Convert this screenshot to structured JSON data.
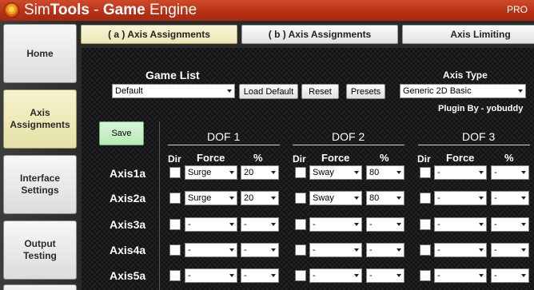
{
  "titlebar": {
    "brand_light": "Sim",
    "brand_bold": "Tools",
    "separator": " - ",
    "module_bold": "Game",
    "module_light": " Engine",
    "edition": "PRO"
  },
  "sidebar": {
    "items": [
      {
        "label": "Home"
      },
      {
        "label": "Axis Assignments",
        "active": true
      },
      {
        "label": "Interface Settings"
      },
      {
        "label": "Output Testing"
      }
    ]
  },
  "tabs": [
    {
      "label": "( a ) Axis Assignments",
      "active": true
    },
    {
      "label": "( b ) Axis Assignments"
    },
    {
      "label": "Axis Limiting"
    }
  ],
  "game_list": {
    "heading": "Game List",
    "selected": "Default"
  },
  "buttons": {
    "load_default": "Load Default",
    "reset": "Reset",
    "presets": "Presets",
    "save": "Save"
  },
  "axis_type": {
    "heading": "Axis Type",
    "selected": "Generic 2D Basic"
  },
  "plugin_by": "Plugin By - yobuddy",
  "dof_headers": [
    "DOF 1",
    "DOF 2",
    "DOF 3"
  ],
  "col_headers": {
    "dir": "Dir",
    "force": "Force",
    "percent": "%"
  },
  "axes": [
    {
      "name": "Axis1a",
      "dof": [
        {
          "force": "Surge",
          "percent": "20"
        },
        {
          "force": "Sway",
          "percent": "80"
        },
        {
          "force": "-",
          "percent": "-"
        }
      ]
    },
    {
      "name": "Axis2a",
      "dof": [
        {
          "force": "Surge",
          "percent": "20"
        },
        {
          "force": "Sway",
          "percent": "80"
        },
        {
          "force": "-",
          "percent": "-"
        }
      ]
    },
    {
      "name": "Axis3a",
      "dof": [
        {
          "force": "-",
          "percent": "-"
        },
        {
          "force": "-",
          "percent": "-"
        },
        {
          "force": "-",
          "percent": "-"
        }
      ]
    },
    {
      "name": "Axis4a",
      "dof": [
        {
          "force": "-",
          "percent": "-"
        },
        {
          "force": "-",
          "percent": "-"
        },
        {
          "force": "-",
          "percent": "-"
        }
      ]
    },
    {
      "name": "Axis5a",
      "dof": [
        {
          "force": "-",
          "percent": "-"
        },
        {
          "force": "-",
          "percent": "-"
        },
        {
          "force": "-",
          "percent": "-"
        }
      ]
    }
  ],
  "colors": {
    "titlebar": "#b73015",
    "active_tab": "#ebe7b5",
    "save_button": "#b8eab8",
    "panel": "#141414"
  }
}
